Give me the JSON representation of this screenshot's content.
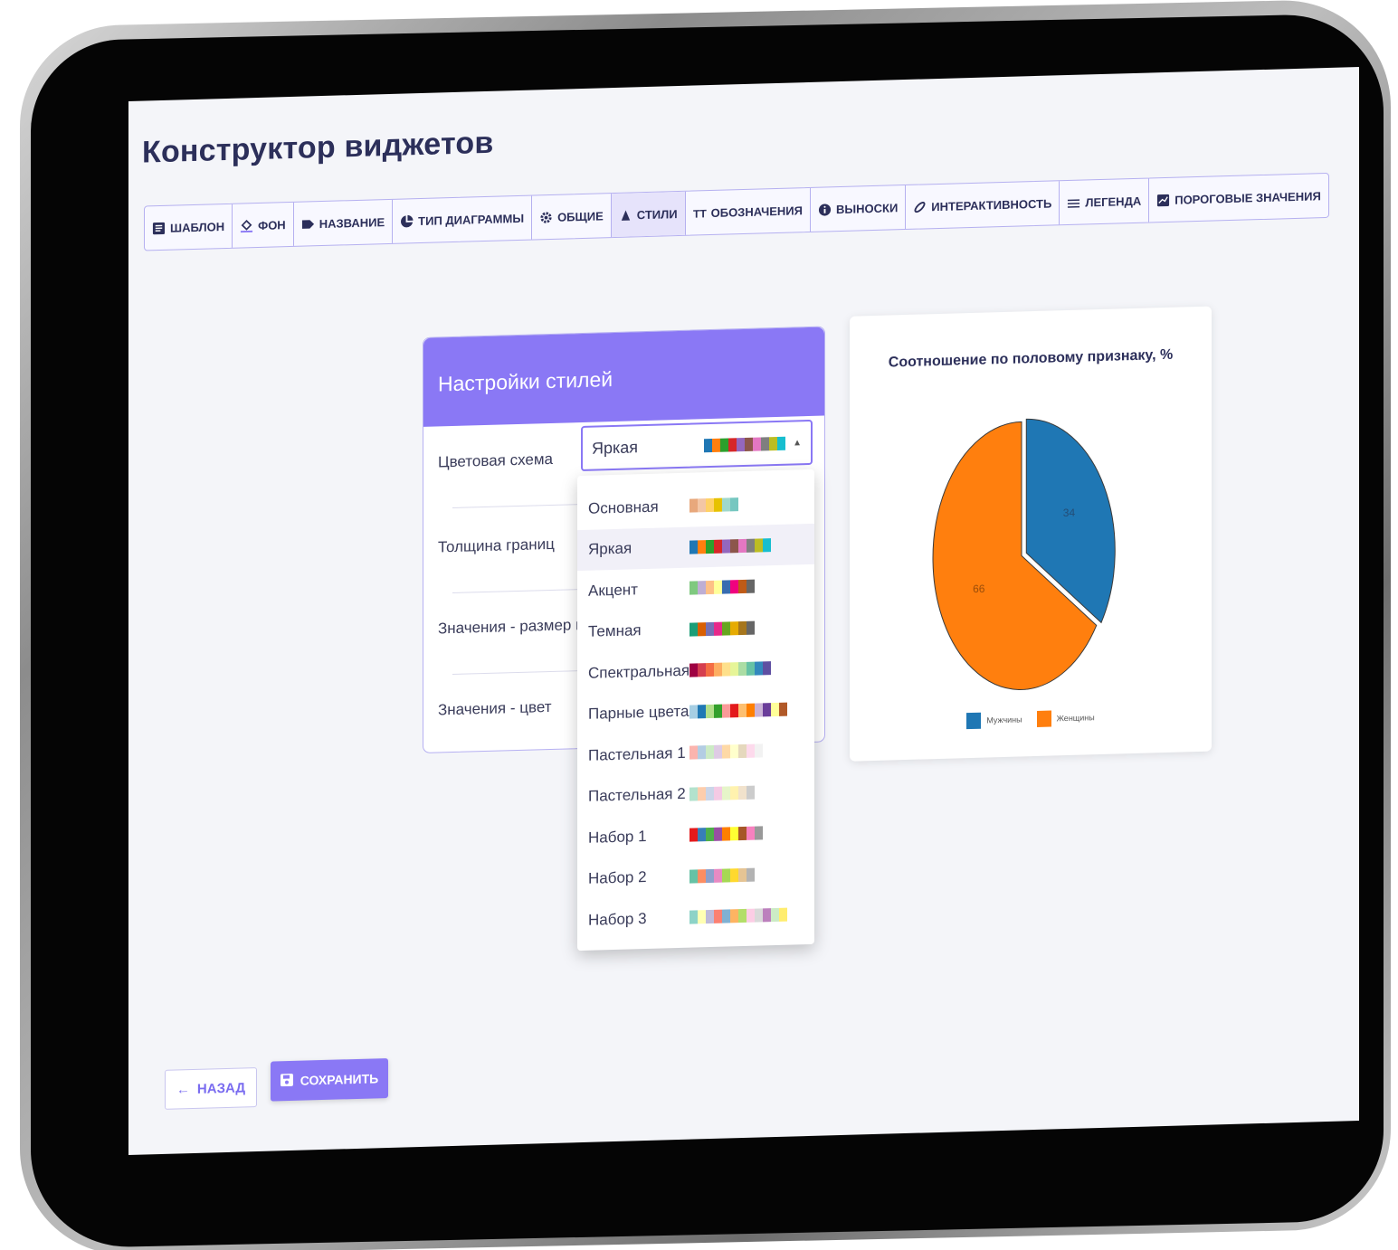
{
  "page_title": "Конструктор виджетов",
  "tabs": [
    {
      "label": "ШАБЛОН",
      "icon": "template-icon",
      "active": false
    },
    {
      "label": "ФОН",
      "icon": "paint-bucket-icon",
      "active": false
    },
    {
      "label": "НАЗВАНИЕ",
      "icon": "label-icon",
      "active": false
    },
    {
      "label": "ТИП ДИАГРАММЫ",
      "icon": "pie-chart-icon",
      "active": false
    },
    {
      "label": "ОБЩИЕ",
      "icon": "gear-icon",
      "active": false
    },
    {
      "label": "СТИЛИ",
      "icon": "palette-icon",
      "active": true
    },
    {
      "label": "ОБОЗНАЧЕНИЯ",
      "icon": "text-size-icon",
      "active": false
    },
    {
      "label": "ВЫНОСКИ",
      "icon": "info-icon",
      "active": false
    },
    {
      "label": "ИНТЕРАКТИВНОСТЬ",
      "icon": "link-icon",
      "active": false
    },
    {
      "label": "ЛЕГЕНДА",
      "icon": "legend-icon",
      "active": false
    },
    {
      "label": "ПОРОГОВЫЕ ЗНАЧЕНИЯ",
      "icon": "threshold-icon",
      "active": false
    }
  ],
  "settings": {
    "header": "Настройки стилей",
    "rows": {
      "color_scheme": "Цветовая схема",
      "border_width": "Толщина границ",
      "value_font_size": "Значения - размер шр",
      "value_color": "Значения - цвет"
    },
    "selected_scheme": "Яркая"
  },
  "dropdown": {
    "options": [
      {
        "label": "Основная",
        "selected": false,
        "colors": [
          "#e8a87c",
          "#f3c6a5",
          "#ffd166",
          "#e6c200",
          "#9fd8cb",
          "#76c7c0"
        ]
      },
      {
        "label": "Яркая",
        "selected": true,
        "colors": [
          "#1f77b4",
          "#ff7f0e",
          "#2ca02c",
          "#d62728",
          "#9467bd",
          "#8c564b",
          "#e377c2",
          "#7f7f7f",
          "#bcbd22",
          "#17becf"
        ]
      },
      {
        "label": "Акцент",
        "selected": false,
        "colors": [
          "#7fc97f",
          "#beaed4",
          "#fdc086",
          "#ffff99",
          "#386cb0",
          "#f0027f",
          "#bf5b17",
          "#666666"
        ]
      },
      {
        "label": "Темная",
        "selected": false,
        "colors": [
          "#1b9e77",
          "#d95f02",
          "#7570b3",
          "#e7298a",
          "#66a61e",
          "#e6ab02",
          "#a6761d",
          "#666666"
        ]
      },
      {
        "label": "Спектральная",
        "selected": false,
        "colors": [
          "#9e0142",
          "#d53e4f",
          "#f46d43",
          "#fdae61",
          "#fee08b",
          "#e6f598",
          "#abdda4",
          "#66c2a5",
          "#3288bd",
          "#5e4fa2"
        ]
      },
      {
        "label": "Парные цвета",
        "selected": false,
        "colors": [
          "#a6cee3",
          "#1f78b4",
          "#b2df8a",
          "#33a02c",
          "#fb9a99",
          "#e31a1c",
          "#fdbf6f",
          "#ff7f00",
          "#cab2d6",
          "#6a3d9a",
          "#ffff99",
          "#b15928"
        ]
      },
      {
        "label": "Пастельная 1",
        "selected": false,
        "colors": [
          "#fbb4ae",
          "#b3cde3",
          "#ccebc5",
          "#decbe4",
          "#fed9a6",
          "#ffffcc",
          "#e5d8bd",
          "#fddaec",
          "#f2f2f2"
        ]
      },
      {
        "label": "Пастельная 2",
        "selected": false,
        "colors": [
          "#b3e2cd",
          "#fdcdac",
          "#cbd5e8",
          "#f4cae4",
          "#e6f5c9",
          "#fff2ae",
          "#f1e2cc",
          "#cccccc"
        ]
      },
      {
        "label": "Набор 1",
        "selected": false,
        "colors": [
          "#e41a1c",
          "#377eb8",
          "#4daf4a",
          "#984ea3",
          "#ff7f00",
          "#ffff33",
          "#a65628",
          "#f781bf",
          "#999999"
        ]
      },
      {
        "label": "Набор 2",
        "selected": false,
        "colors": [
          "#66c2a5",
          "#fc8d62",
          "#8da0cb",
          "#e78ac3",
          "#a6d854",
          "#ffd92f",
          "#e5c494",
          "#b3b3b3"
        ]
      },
      {
        "label": "Набор 3",
        "selected": false,
        "colors": [
          "#8dd3c7",
          "#ffffb3",
          "#bebada",
          "#fb8072",
          "#80b1d3",
          "#fdb462",
          "#b3de69",
          "#fccde5",
          "#d9d9d9",
          "#bc80bd",
          "#ccebc5",
          "#ffed6f"
        ]
      }
    ]
  },
  "chart_data": {
    "type": "pie",
    "title": "Соотношение по половому признаку, %",
    "categories": [
      "Мужчины",
      "Женщины"
    ],
    "values": [
      34,
      66
    ],
    "colors": [
      "#1f77b4",
      "#ff7f0e"
    ],
    "data_labels": [
      "34",
      "66"
    ],
    "legend_position": "bottom"
  },
  "buttons": {
    "back": "НАЗАД",
    "save": "СОХРАНИТЬ"
  }
}
